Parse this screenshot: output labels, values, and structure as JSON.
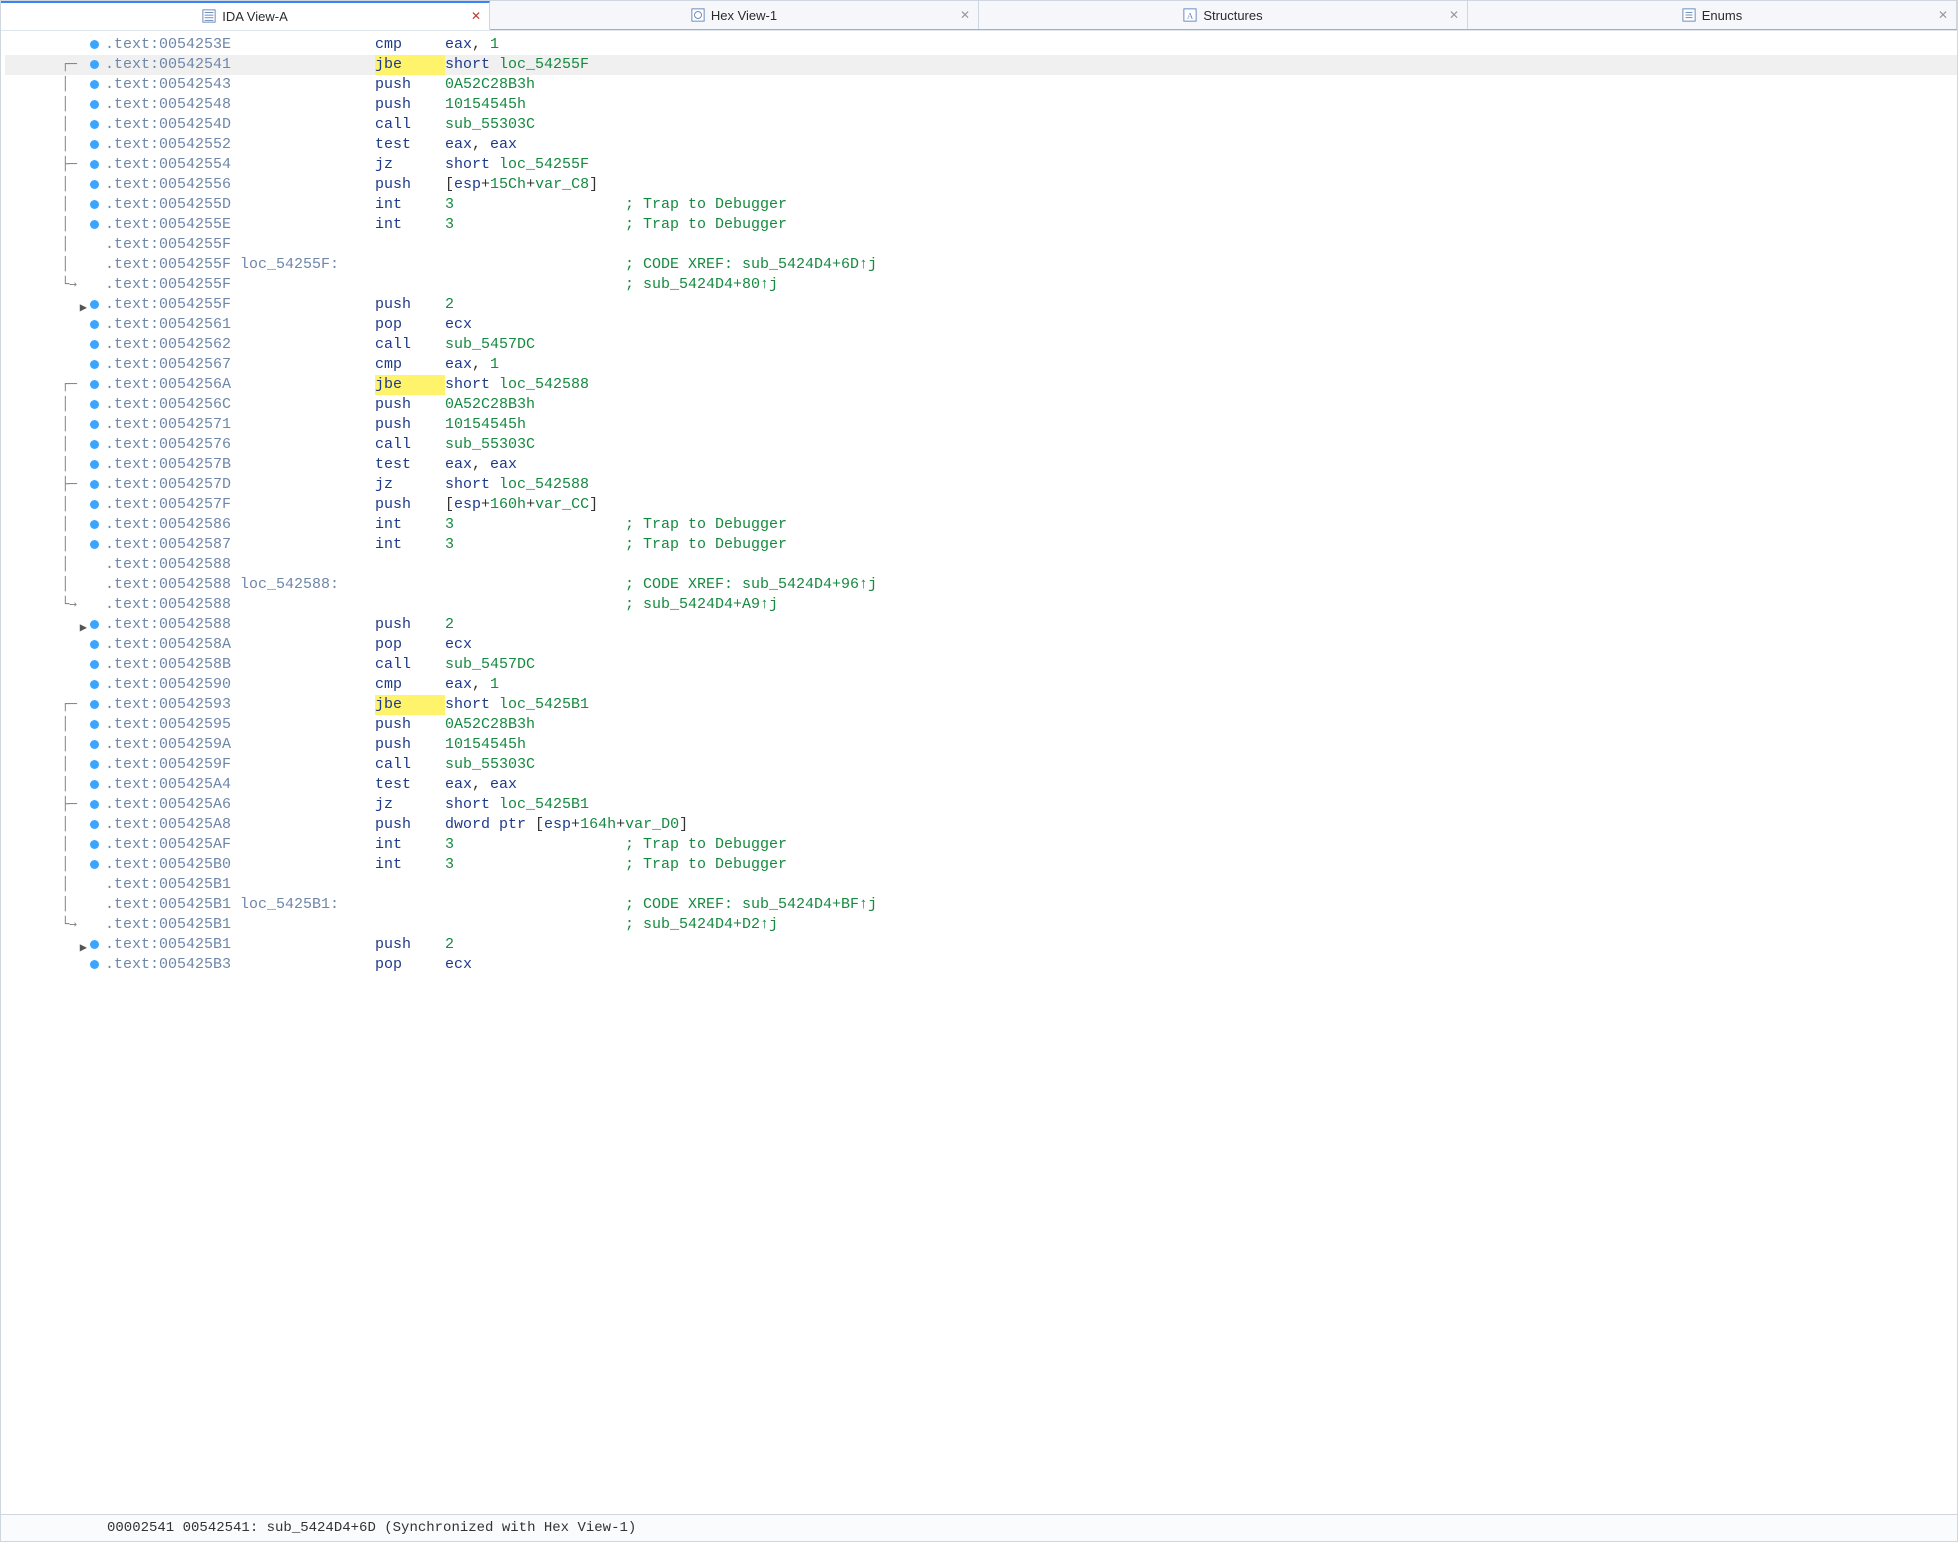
{
  "tabs": [
    {
      "label": "IDA View-A",
      "icon": "list-view-icon",
      "active": true,
      "closeColor": "#c0392b"
    },
    {
      "label": "Hex View-1",
      "icon": "hex-view-icon",
      "active": false
    },
    {
      "label": "Structures",
      "icon": "struct-icon",
      "active": false
    },
    {
      "label": "Enums",
      "icon": "enum-icon",
      "active": false
    }
  ],
  "statusbar": "00002541 00542541: sub_5424D4+6D (Synchronized with Hex View-1)",
  "colors": {
    "address": "#6e87a9",
    "mnemonic": "#1e3a8a",
    "numberOrIdent": "#168a3f",
    "comment": "#168a3f",
    "jbeHighlight": "#fff36b",
    "breakpointDot": "#3aa6ff"
  },
  "lines": [
    {
      "dot": true,
      "flow": "",
      "arrow": "",
      "addr": ".text:0054253E",
      "label": "",
      "mn": "cmp",
      "hl": false,
      "ops": [
        [
          "reg",
          "eax"
        ],
        [
          "plain",
          ", "
        ],
        [
          "num",
          "1"
        ]
      ],
      "cmt": "",
      "highlightRow": false
    },
    {
      "dot": true,
      "flow": "┌─",
      "arrow": "",
      "addr": ".text:00542541",
      "label": "",
      "mn": "jbe",
      "hl": true,
      "ops": [
        [
          "kw",
          "short "
        ],
        [
          "id",
          "loc_54255F"
        ]
      ],
      "cmt": "",
      "highlightRow": true
    },
    {
      "dot": true,
      "flow": "│ ",
      "arrow": "",
      "addr": ".text:00542543",
      "label": "",
      "mn": "push",
      "hl": false,
      "ops": [
        [
          "num",
          "0A52C28B3h"
        ]
      ],
      "cmt": "",
      "highlightRow": false
    },
    {
      "dot": true,
      "flow": "│ ",
      "arrow": "",
      "addr": ".text:00542548",
      "label": "",
      "mn": "push",
      "hl": false,
      "ops": [
        [
          "num",
          "10154545h"
        ]
      ],
      "cmt": "",
      "highlightRow": false
    },
    {
      "dot": true,
      "flow": "│ ",
      "arrow": "",
      "addr": ".text:0054254D",
      "label": "",
      "mn": "call",
      "hl": false,
      "ops": [
        [
          "id",
          "sub_55303C"
        ]
      ],
      "cmt": "",
      "highlightRow": false
    },
    {
      "dot": true,
      "flow": "│ ",
      "arrow": "",
      "addr": ".text:00542552",
      "label": "",
      "mn": "test",
      "hl": false,
      "ops": [
        [
          "reg",
          "eax"
        ],
        [
          "plain",
          ", "
        ],
        [
          "reg",
          "eax"
        ]
      ],
      "cmt": "",
      "highlightRow": false
    },
    {
      "dot": true,
      "flow": "├─",
      "arrow": "",
      "addr": ".text:00542554",
      "label": "",
      "mn": "jz",
      "hl": false,
      "ops": [
        [
          "kw",
          "short "
        ],
        [
          "id",
          "loc_54255F"
        ]
      ],
      "cmt": "",
      "highlightRow": false
    },
    {
      "dot": true,
      "flow": "│ ",
      "arrow": "",
      "addr": ".text:00542556",
      "label": "",
      "mn": "push",
      "hl": false,
      "ops": [
        [
          "plain",
          "["
        ],
        [
          "reg",
          "esp"
        ],
        [
          "plain",
          "+"
        ],
        [
          "num",
          "15Ch"
        ],
        [
          "plain",
          "+"
        ],
        [
          "id",
          "var_C8"
        ],
        [
          "plain",
          "]"
        ]
      ],
      "cmt": "",
      "highlightRow": false
    },
    {
      "dot": true,
      "flow": "│ ",
      "arrow": "",
      "addr": ".text:0054255D",
      "label": "",
      "mn": "int",
      "hl": false,
      "ops": [
        [
          "num",
          "3"
        ]
      ],
      "cmt": "; Trap to Debugger",
      "highlightRow": false
    },
    {
      "dot": true,
      "flow": "│ ",
      "arrow": "",
      "addr": ".text:0054255E",
      "label": "",
      "mn": "int",
      "hl": false,
      "ops": [
        [
          "num",
          "3"
        ]
      ],
      "cmt": "; Trap to Debugger",
      "highlightRow": false
    },
    {
      "dot": false,
      "flow": "│ ",
      "arrow": "",
      "addr": ".text:0054255F",
      "label": "",
      "mn": "",
      "hl": false,
      "ops": [],
      "cmt": "",
      "highlightRow": false
    },
    {
      "dot": false,
      "flow": "│ ",
      "arrow": "",
      "addr": ".text:0054255F",
      "label": "loc_54255F:",
      "mn": "",
      "hl": false,
      "ops": [],
      "cmt": "; CODE XREF: sub_5424D4+6D↑j",
      "highlightRow": false
    },
    {
      "dot": false,
      "flow": "└→",
      "arrow": "",
      "addr": ".text:0054255F",
      "label": "",
      "mn": "",
      "hl": false,
      "ops": [],
      "cmt": "; sub_5424D4+80↑j",
      "highlightRow": false
    },
    {
      "dot": true,
      "flow": "",
      "arrow": "→",
      "addr": ".text:0054255F",
      "label": "",
      "mn": "push",
      "hl": false,
      "ops": [
        [
          "num",
          "2"
        ]
      ],
      "cmt": "",
      "highlightRow": false
    },
    {
      "dot": true,
      "flow": "",
      "arrow": "",
      "addr": ".text:00542561",
      "label": "",
      "mn": "pop",
      "hl": false,
      "ops": [
        [
          "reg",
          "ecx"
        ]
      ],
      "cmt": "",
      "highlightRow": false
    },
    {
      "dot": true,
      "flow": "",
      "arrow": "",
      "addr": ".text:00542562",
      "label": "",
      "mn": "call",
      "hl": false,
      "ops": [
        [
          "id",
          "sub_5457DC"
        ]
      ],
      "cmt": "",
      "highlightRow": false
    },
    {
      "dot": true,
      "flow": "",
      "arrow": "",
      "addr": ".text:00542567",
      "label": "",
      "mn": "cmp",
      "hl": false,
      "ops": [
        [
          "reg",
          "eax"
        ],
        [
          "plain",
          ", "
        ],
        [
          "num",
          "1"
        ]
      ],
      "cmt": "",
      "highlightRow": false
    },
    {
      "dot": true,
      "flow": "┌─",
      "arrow": "",
      "addr": ".text:0054256A",
      "label": "",
      "mn": "jbe",
      "hl": true,
      "ops": [
        [
          "kw",
          "short "
        ],
        [
          "id",
          "loc_542588"
        ]
      ],
      "cmt": "",
      "highlightRow": false
    },
    {
      "dot": true,
      "flow": "│ ",
      "arrow": "",
      "addr": ".text:0054256C",
      "label": "",
      "mn": "push",
      "hl": false,
      "ops": [
        [
          "num",
          "0A52C28B3h"
        ]
      ],
      "cmt": "",
      "highlightRow": false
    },
    {
      "dot": true,
      "flow": "│ ",
      "arrow": "",
      "addr": ".text:00542571",
      "label": "",
      "mn": "push",
      "hl": false,
      "ops": [
        [
          "num",
          "10154545h"
        ]
      ],
      "cmt": "",
      "highlightRow": false
    },
    {
      "dot": true,
      "flow": "│ ",
      "arrow": "",
      "addr": ".text:00542576",
      "label": "",
      "mn": "call",
      "hl": false,
      "ops": [
        [
          "id",
          "sub_55303C"
        ]
      ],
      "cmt": "",
      "highlightRow": false
    },
    {
      "dot": true,
      "flow": "│ ",
      "arrow": "",
      "addr": ".text:0054257B",
      "label": "",
      "mn": "test",
      "hl": false,
      "ops": [
        [
          "reg",
          "eax"
        ],
        [
          "plain",
          ", "
        ],
        [
          "reg",
          "eax"
        ]
      ],
      "cmt": "",
      "highlightRow": false
    },
    {
      "dot": true,
      "flow": "├─",
      "arrow": "",
      "addr": ".text:0054257D",
      "label": "",
      "mn": "jz",
      "hl": false,
      "ops": [
        [
          "kw",
          "short "
        ],
        [
          "id",
          "loc_542588"
        ]
      ],
      "cmt": "",
      "highlightRow": false
    },
    {
      "dot": true,
      "flow": "│ ",
      "arrow": "",
      "addr": ".text:0054257F",
      "label": "",
      "mn": "push",
      "hl": false,
      "ops": [
        [
          "plain",
          "["
        ],
        [
          "reg",
          "esp"
        ],
        [
          "plain",
          "+"
        ],
        [
          "num",
          "160h"
        ],
        [
          "plain",
          "+"
        ],
        [
          "id",
          "var_CC"
        ],
        [
          "plain",
          "]"
        ]
      ],
      "cmt": "",
      "highlightRow": false
    },
    {
      "dot": true,
      "flow": "│ ",
      "arrow": "",
      "addr": ".text:00542586",
      "label": "",
      "mn": "int",
      "hl": false,
      "ops": [
        [
          "num",
          "3"
        ]
      ],
      "cmt": "; Trap to Debugger",
      "highlightRow": false
    },
    {
      "dot": true,
      "flow": "│ ",
      "arrow": "",
      "addr": ".text:00542587",
      "label": "",
      "mn": "int",
      "hl": false,
      "ops": [
        [
          "num",
          "3"
        ]
      ],
      "cmt": "; Trap to Debugger",
      "highlightRow": false
    },
    {
      "dot": false,
      "flow": "│ ",
      "arrow": "",
      "addr": ".text:00542588",
      "label": "",
      "mn": "",
      "hl": false,
      "ops": [],
      "cmt": "",
      "highlightRow": false
    },
    {
      "dot": false,
      "flow": "│ ",
      "arrow": "",
      "addr": ".text:00542588",
      "label": "loc_542588:",
      "mn": "",
      "hl": false,
      "ops": [],
      "cmt": "; CODE XREF: sub_5424D4+96↑j",
      "highlightRow": false
    },
    {
      "dot": false,
      "flow": "└→",
      "arrow": "",
      "addr": ".text:00542588",
      "label": "",
      "mn": "",
      "hl": false,
      "ops": [],
      "cmt": "; sub_5424D4+A9↑j",
      "highlightRow": false
    },
    {
      "dot": true,
      "flow": "",
      "arrow": "→",
      "addr": ".text:00542588",
      "label": "",
      "mn": "push",
      "hl": false,
      "ops": [
        [
          "num",
          "2"
        ]
      ],
      "cmt": "",
      "highlightRow": false
    },
    {
      "dot": true,
      "flow": "",
      "arrow": "",
      "addr": ".text:0054258A",
      "label": "",
      "mn": "pop",
      "hl": false,
      "ops": [
        [
          "reg",
          "ecx"
        ]
      ],
      "cmt": "",
      "highlightRow": false
    },
    {
      "dot": true,
      "flow": "",
      "arrow": "",
      "addr": ".text:0054258B",
      "label": "",
      "mn": "call",
      "hl": false,
      "ops": [
        [
          "id",
          "sub_5457DC"
        ]
      ],
      "cmt": "",
      "highlightRow": false
    },
    {
      "dot": true,
      "flow": "",
      "arrow": "",
      "addr": ".text:00542590",
      "label": "",
      "mn": "cmp",
      "hl": false,
      "ops": [
        [
          "reg",
          "eax"
        ],
        [
          "plain",
          ", "
        ],
        [
          "num",
          "1"
        ]
      ],
      "cmt": "",
      "highlightRow": false
    },
    {
      "dot": true,
      "flow": "┌─",
      "arrow": "",
      "addr": ".text:00542593",
      "label": "",
      "mn": "jbe",
      "hl": true,
      "ops": [
        [
          "kw",
          "short "
        ],
        [
          "id",
          "loc_5425B1"
        ]
      ],
      "cmt": "",
      "highlightRow": false
    },
    {
      "dot": true,
      "flow": "│ ",
      "arrow": "",
      "addr": ".text:00542595",
      "label": "",
      "mn": "push",
      "hl": false,
      "ops": [
        [
          "num",
          "0A52C28B3h"
        ]
      ],
      "cmt": "",
      "highlightRow": false
    },
    {
      "dot": true,
      "flow": "│ ",
      "arrow": "",
      "addr": ".text:0054259A",
      "label": "",
      "mn": "push",
      "hl": false,
      "ops": [
        [
          "num",
          "10154545h"
        ]
      ],
      "cmt": "",
      "highlightRow": false
    },
    {
      "dot": true,
      "flow": "│ ",
      "arrow": "",
      "addr": ".text:0054259F",
      "label": "",
      "mn": "call",
      "hl": false,
      "ops": [
        [
          "id",
          "sub_55303C"
        ]
      ],
      "cmt": "",
      "highlightRow": false
    },
    {
      "dot": true,
      "flow": "│ ",
      "arrow": "",
      "addr": ".text:005425A4",
      "label": "",
      "mn": "test",
      "hl": false,
      "ops": [
        [
          "reg",
          "eax"
        ],
        [
          "plain",
          ", "
        ],
        [
          "reg",
          "eax"
        ]
      ],
      "cmt": "",
      "highlightRow": false
    },
    {
      "dot": true,
      "flow": "├─",
      "arrow": "",
      "addr": ".text:005425A6",
      "label": "",
      "mn": "jz",
      "hl": false,
      "ops": [
        [
          "kw",
          "short "
        ],
        [
          "id",
          "loc_5425B1"
        ]
      ],
      "cmt": "",
      "highlightRow": false
    },
    {
      "dot": true,
      "flow": "│ ",
      "arrow": "",
      "addr": ".text:005425A8",
      "label": "",
      "mn": "push",
      "hl": false,
      "ops": [
        [
          "kw",
          "dword ptr "
        ],
        [
          "plain",
          "["
        ],
        [
          "reg",
          "esp"
        ],
        [
          "plain",
          "+"
        ],
        [
          "num",
          "164h"
        ],
        [
          "plain",
          "+"
        ],
        [
          "id",
          "var_D0"
        ],
        [
          "plain",
          "]"
        ]
      ],
      "cmt": "",
      "highlightRow": false
    },
    {
      "dot": true,
      "flow": "│ ",
      "arrow": "",
      "addr": ".text:005425AF",
      "label": "",
      "mn": "int",
      "hl": false,
      "ops": [
        [
          "num",
          "3"
        ]
      ],
      "cmt": "; Trap to Debugger",
      "highlightRow": false
    },
    {
      "dot": true,
      "flow": "│ ",
      "arrow": "",
      "addr": ".text:005425B0",
      "label": "",
      "mn": "int",
      "hl": false,
      "ops": [
        [
          "num",
          "3"
        ]
      ],
      "cmt": "; Trap to Debugger",
      "highlightRow": false
    },
    {
      "dot": false,
      "flow": "│ ",
      "arrow": "",
      "addr": ".text:005425B1",
      "label": "",
      "mn": "",
      "hl": false,
      "ops": [],
      "cmt": "",
      "highlightRow": false
    },
    {
      "dot": false,
      "flow": "│ ",
      "arrow": "",
      "addr": ".text:005425B1",
      "label": "loc_5425B1:",
      "mn": "",
      "hl": false,
      "ops": [],
      "cmt": "; CODE XREF: sub_5424D4+BF↑j",
      "highlightRow": false
    },
    {
      "dot": false,
      "flow": "└→",
      "arrow": "",
      "addr": ".text:005425B1",
      "label": "",
      "mn": "",
      "hl": false,
      "ops": [],
      "cmt": "; sub_5424D4+D2↑j",
      "highlightRow": false
    },
    {
      "dot": true,
      "flow": "",
      "arrow": "→",
      "addr": ".text:005425B1",
      "label": "",
      "mn": "push",
      "hl": false,
      "ops": [
        [
          "num",
          "2"
        ]
      ],
      "cmt": "",
      "highlightRow": false
    },
    {
      "dot": true,
      "flow": "",
      "arrow": "",
      "addr": ".text:005425B3",
      "label": "",
      "mn": "pop",
      "hl": false,
      "ops": [
        [
          "reg",
          "ecx"
        ]
      ],
      "cmt": "",
      "highlightRow": false
    }
  ]
}
